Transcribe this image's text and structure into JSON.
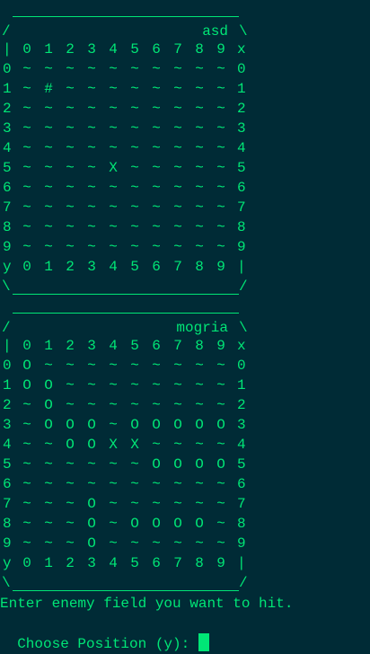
{
  "colors": {
    "background": "#002b36",
    "text": "#00e676"
  },
  "header_labels": [
    "|",
    "0",
    "1",
    "2",
    "3",
    "4",
    "5",
    "6",
    "7",
    "8",
    "9",
    "x"
  ],
  "footer_labels": [
    "y",
    "0",
    "1",
    "2",
    "3",
    "4",
    "5",
    "6",
    "7",
    "8",
    "9",
    "|"
  ],
  "boards": [
    {
      "name": "asd",
      "rows": [
        "~ ~ ~ ~ ~ ~ ~ ~ ~ ~",
        "~ # ~ ~ ~ ~ ~ ~ ~ ~",
        "~ ~ ~ ~ ~ ~ ~ ~ ~ ~",
        "~ ~ ~ ~ ~ ~ ~ ~ ~ ~",
        "~ ~ ~ ~ ~ ~ ~ ~ ~ ~",
        "~ ~ ~ ~ X ~ ~ ~ ~ ~",
        "~ ~ ~ ~ ~ ~ ~ ~ ~ ~",
        "~ ~ ~ ~ ~ ~ ~ ~ ~ ~",
        "~ ~ ~ ~ ~ ~ ~ ~ ~ ~",
        "~ ~ ~ ~ ~ ~ ~ ~ ~ ~"
      ]
    },
    {
      "name": "mogria",
      "rows": [
        "O ~ ~ ~ ~ ~ ~ ~ ~ ~",
        "O O ~ ~ ~ ~ ~ ~ ~ ~",
        "~ O ~ ~ ~ ~ ~ ~ ~ ~",
        "~ O O O ~ O O O O O",
        "~ ~ O O X X ~ ~ ~ ~",
        "~ ~ ~ ~ ~ ~ O O O O",
        "~ ~ ~ ~ ~ ~ ~ ~ ~ ~",
        "~ ~ ~ O ~ ~ ~ ~ ~ ~",
        "~ ~ ~ O ~ O O O O ~",
        "~ ~ ~ O ~ ~ ~ ~ ~ ~"
      ]
    }
  ],
  "prompt": {
    "line1": "Enter enemy field you want to hit.",
    "line2": "Choose Position (y): "
  }
}
